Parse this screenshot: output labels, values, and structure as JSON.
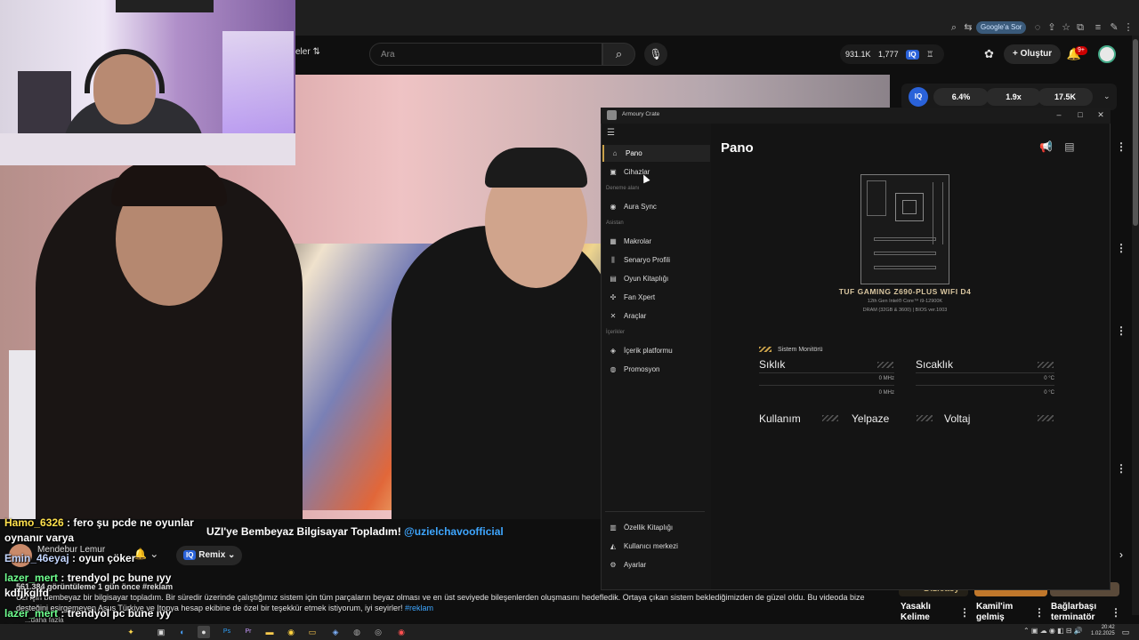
{
  "browser": {
    "google_sor": "Google'a Sor"
  },
  "youtube": {
    "filter_label": "eler",
    "search_placeholder": "Ara",
    "stats": {
      "views": "931.1K",
      "watch": "1,777"
    },
    "create_label": "Oluştur",
    "notif_count": "9+"
  },
  "extension": {
    "logo": "IQ",
    "pills": [
      "6.4%",
      "1.9x",
      "17.5K"
    ]
  },
  "chat": [
    {
      "user": "Hamo_6326",
      "msg": " : fero şu pcde ne oyunlar"
    },
    {
      "user": "",
      "msg": "oynanır varya"
    },
    {
      "user": "Emin_46eyaj",
      "msg": " : oyun çöker"
    },
    {
      "user": "lazer_mert",
      "msg": " : trendyol pc bune ıyy"
    },
    {
      "user": "kdfjkglfd",
      "msg": ""
    },
    {
      "user": "lazer_mert",
      "msg": " : trendyol pc bune ıyy"
    },
    {
      "user": "kdfjkglfd",
      "msg": ""
    }
  ],
  "video": {
    "title": "UZI'ye Bembeyaz Bilgisayar Topladım! ",
    "title_tag": "@uzielchavoofficial",
    "channel": "Mendebur Lemur",
    "remix": "Remix",
    "views": "561.384 görüntüleme  1 gün önce  #reklam",
    "desc": "Uzi için bembeyaz bir bilgisayar topladım. Bir süredir üzerinde çalıştığımız sistem için tüm parçaların beyaz olması ve en üst seviyede bileşenlerden oluşmasını hedefledik. Ortaya çıkan sistem beklediğimizden de güzel oldu. Bu videoda bize desteğini esirgemeyen Asus Türkiye ve Itopya hesap ekibine de özel bir teşekkür etmek istiyorum, iyi seyirler! ",
    "desc_tag": "#reklam",
    "more": "...daha fazla"
  },
  "sidebar_videos": [
    {
      "label": "Yasaklı Kelime",
      "thumb_text": "Dizieasy"
    },
    {
      "label": "Kamil'im gelmiş"
    },
    {
      "label": "Bağlarbaşı terminatör"
    }
  ],
  "armoury": {
    "app_name": "Armoury Crate",
    "nav": [
      {
        "label": "Pano",
        "icon": "⌂"
      },
      {
        "label": "Cihazlar",
        "icon": "▣"
      }
    ],
    "sec_deneme": "Deneme alanı",
    "nav_aura": {
      "label": "Aura Sync",
      "icon": "◉"
    },
    "sec_asistan": "Asistan",
    "nav_asistan": [
      {
        "label": "Makrolar",
        "icon": "▦"
      },
      {
        "label": "Senaryo Profili",
        "icon": "⫼"
      },
      {
        "label": "Oyun Kitaplığı",
        "icon": "▤"
      },
      {
        "label": "Fan Xpert",
        "icon": "✣"
      },
      {
        "label": "Araçlar",
        "icon": "✕"
      }
    ],
    "sec_icerikler": "İçerikler",
    "nav_icerik": [
      {
        "label": "İçerik platformu",
        "icon": "◈"
      },
      {
        "label": "Promosyon",
        "icon": "◍"
      }
    ],
    "nav_bottom": [
      {
        "label": "Özellik Kitaplığı",
        "icon": "▥"
      },
      {
        "label": "Kullanıcı merkezi",
        "icon": "◭"
      },
      {
        "label": "Ayarlar",
        "icon": "⚙"
      }
    ],
    "page_title": "Pano",
    "motherboard": "TUF GAMING Z690-PLUS WIFI D4",
    "cpu": "12th Gen Intel® Core™ i9-12900K",
    "dram": "DRAM (32GB & 3600) | BIOS ver.1003",
    "sysmon": "Sistem Monitörü",
    "freq_label": "Sıklık",
    "temp_label": "Sıcaklık",
    "freq_vals": [
      "0 MHz",
      "0 MHz"
    ],
    "temp_vals": [
      "0 °C",
      "0 °C"
    ],
    "usage_label": "Kullanım",
    "fan_label": "Yelpaze",
    "volt_label": "Voltaj"
  },
  "taskbar": {
    "time": "20:42",
    "date": "1.02.2025"
  }
}
